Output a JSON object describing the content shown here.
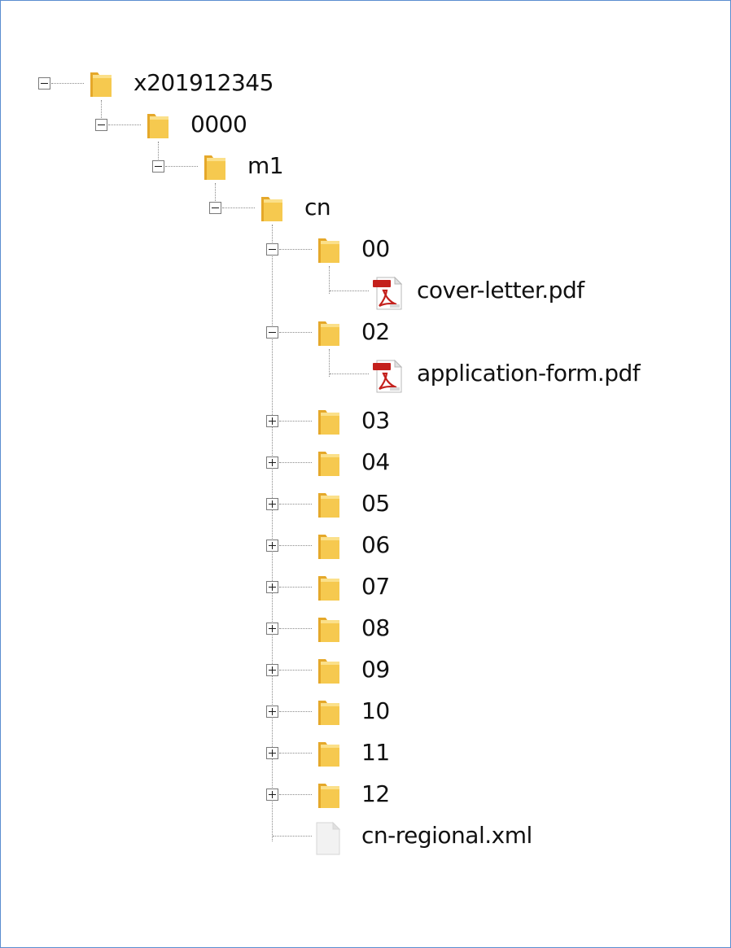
{
  "tree": {
    "root": {
      "label": "x201912345",
      "icon": "folder-icon",
      "state": "expanded"
    },
    "level1": {
      "label": "0000",
      "icon": "folder-icon",
      "state": "expanded"
    },
    "level2": {
      "label": "m1",
      "icon": "folder-icon",
      "state": "expanded"
    },
    "level3": {
      "label": "cn",
      "icon": "folder-icon",
      "state": "expanded"
    },
    "children": [
      {
        "label": "00",
        "icon": "folder-icon",
        "state": "expanded"
      },
      {
        "label": "cover-letter.pdf",
        "icon": "pdf-icon",
        "state": "leaf"
      },
      {
        "label": "02",
        "icon": "folder-icon",
        "state": "expanded"
      },
      {
        "label": "application-form.pdf",
        "icon": "pdf-icon",
        "state": "leaf"
      },
      {
        "label": "03",
        "icon": "folder-icon",
        "state": "collapsed"
      },
      {
        "label": "04",
        "icon": "folder-icon",
        "state": "collapsed"
      },
      {
        "label": "05",
        "icon": "folder-icon",
        "state": "collapsed"
      },
      {
        "label": "06",
        "icon": "folder-icon",
        "state": "collapsed"
      },
      {
        "label": "07",
        "icon": "folder-icon",
        "state": "collapsed"
      },
      {
        "label": "08",
        "icon": "folder-icon",
        "state": "collapsed"
      },
      {
        "label": "09",
        "icon": "folder-icon",
        "state": "collapsed"
      },
      {
        "label": "10",
        "icon": "folder-icon",
        "state": "collapsed"
      },
      {
        "label": "11",
        "icon": "folder-icon",
        "state": "collapsed"
      },
      {
        "label": "12",
        "icon": "folder-icon",
        "state": "collapsed"
      },
      {
        "label": "cn-regional.xml",
        "icon": "file-icon",
        "state": "leaf"
      }
    ]
  },
  "colors": {
    "frame_border": "#5b8dd0",
    "folder": "#f5c54c",
    "pdf_red": "#c4201c",
    "connector": "#8a8a8a"
  }
}
